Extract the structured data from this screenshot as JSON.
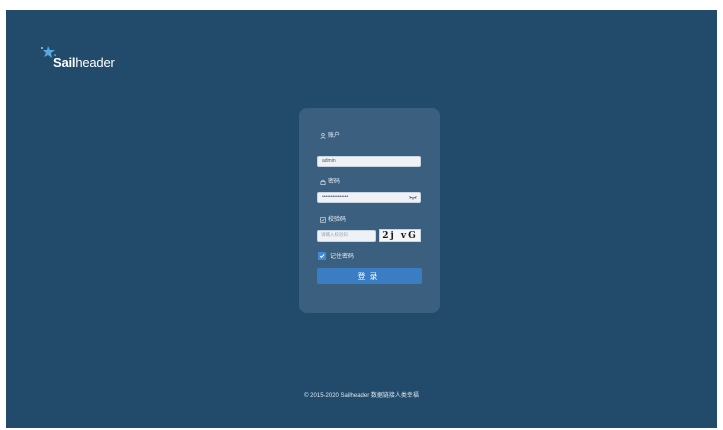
{
  "brand": {
    "name_bold": "Sail",
    "name_regular": "header"
  },
  "login": {
    "account_label": "账户",
    "account_value": "admin",
    "password_label": "密码",
    "password_value": "•••••••••••••••",
    "captcha_label": "校验码",
    "captcha_placeholder": "请输入校验码",
    "captcha_code": "2j vG",
    "remember_label": "记住密码",
    "remember_checked": true,
    "submit_label": "登录"
  },
  "footer": {
    "text": "© 2015-2020 Sailheader 数据链接人类幸福"
  },
  "colors": {
    "background": "#214a6b",
    "button": "#3a7dc2",
    "checkbox": "#3d8bd9"
  }
}
